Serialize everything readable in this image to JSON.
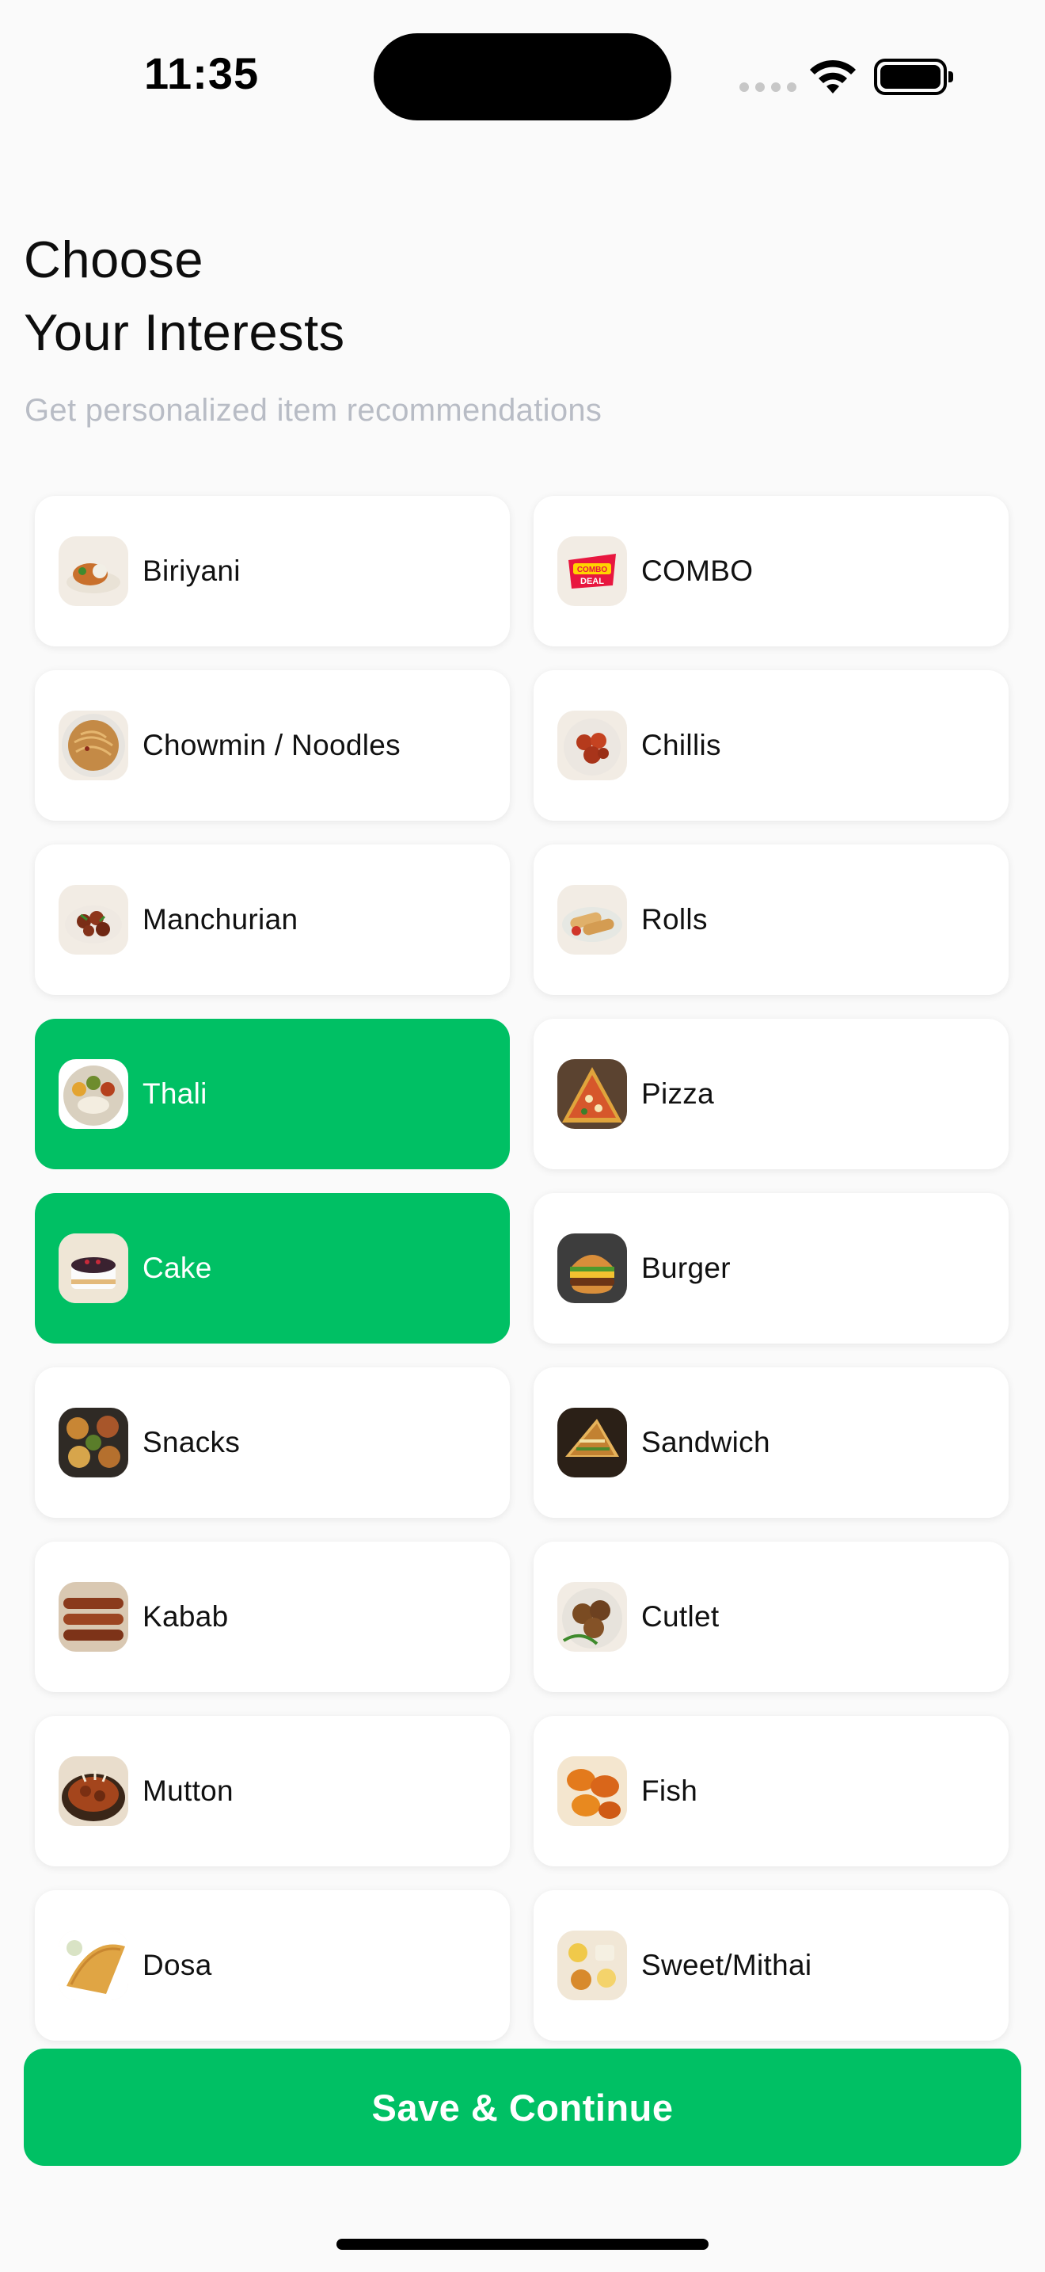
{
  "status_bar": {
    "time": "11:35"
  },
  "header": {
    "title_line1": "Choose",
    "title_line2": "Your Interests",
    "subtitle": "Get personalized item recommendations"
  },
  "categories": [
    {
      "label": "Biriyani",
      "selected": false,
      "icon": "biriyani-icon"
    },
    {
      "label": "COMBO",
      "selected": false,
      "icon": "combo-deal-icon"
    },
    {
      "label": "Chowmin / Noodles",
      "selected": false,
      "icon": "noodles-icon"
    },
    {
      "label": "Chillis",
      "selected": false,
      "icon": "chilli-chicken-icon"
    },
    {
      "label": "Manchurian",
      "selected": false,
      "icon": "manchurian-icon"
    },
    {
      "label": "Rolls",
      "selected": false,
      "icon": "rolls-icon"
    },
    {
      "label": "Thali",
      "selected": true,
      "icon": "thali-icon"
    },
    {
      "label": "Pizza",
      "selected": false,
      "icon": "pizza-icon"
    },
    {
      "label": "Cake",
      "selected": true,
      "icon": "cake-icon"
    },
    {
      "label": "Burger",
      "selected": false,
      "icon": "burger-icon"
    },
    {
      "label": "Snacks",
      "selected": false,
      "icon": "snacks-icon"
    },
    {
      "label": "Sandwich",
      "selected": false,
      "icon": "sandwich-icon"
    },
    {
      "label": "Kabab",
      "selected": false,
      "icon": "kabab-icon"
    },
    {
      "label": "Cutlet",
      "selected": false,
      "icon": "cutlet-icon"
    },
    {
      "label": "Mutton",
      "selected": false,
      "icon": "mutton-icon"
    },
    {
      "label": "Fish",
      "selected": false,
      "icon": "fish-icon"
    },
    {
      "label": "Dosa",
      "selected": false,
      "icon": "dosa-icon"
    },
    {
      "label": "Sweet/Mithai",
      "selected": false,
      "icon": "sweet-mithai-icon"
    }
  ],
  "cta": {
    "label": "Save & Continue"
  },
  "colors": {
    "accent": "#00c064",
    "subtitle": "#b8bcc5",
    "card": "#ffffff",
    "background": "#fafafa"
  }
}
